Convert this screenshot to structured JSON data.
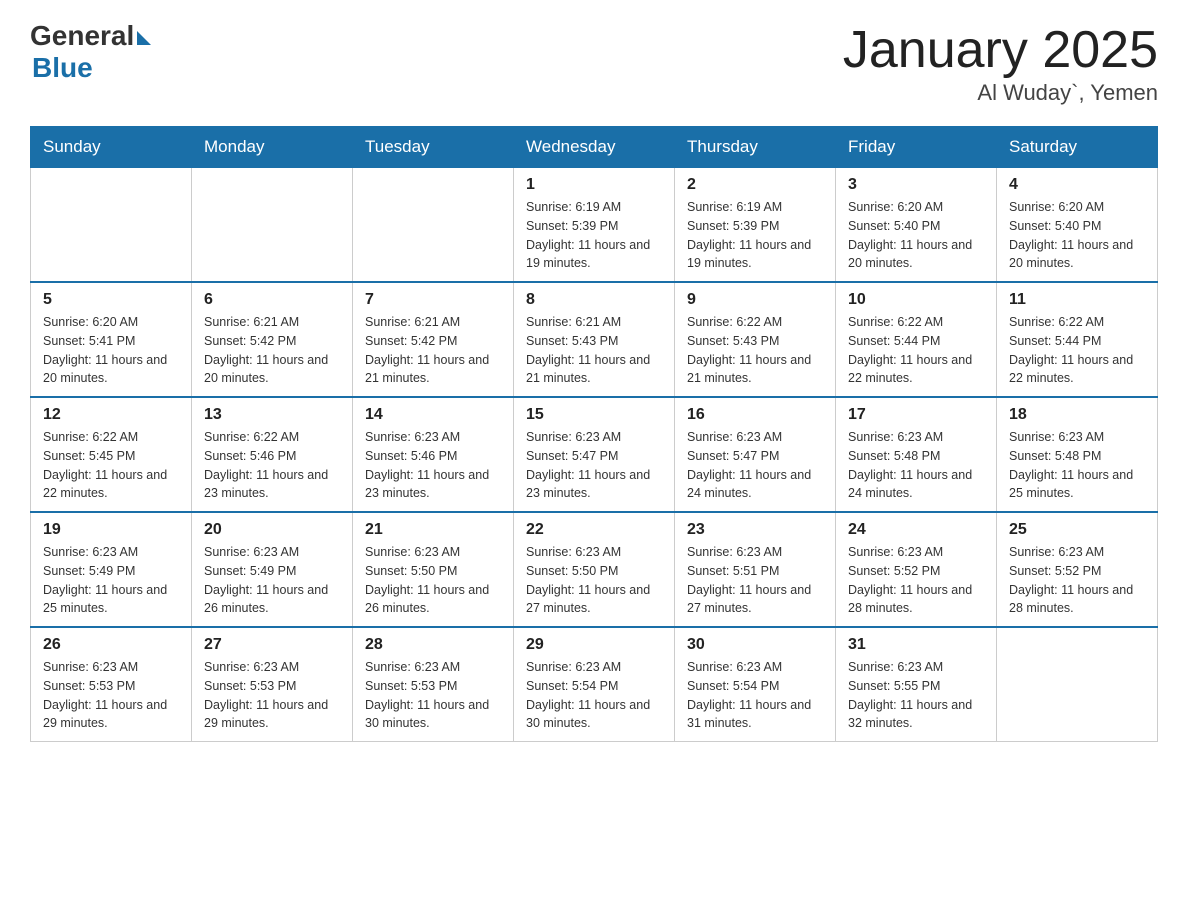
{
  "header": {
    "logo_general": "General",
    "logo_blue": "Blue",
    "month_title": "January 2025",
    "location": "Al Wuday`, Yemen"
  },
  "days_of_week": [
    "Sunday",
    "Monday",
    "Tuesday",
    "Wednesday",
    "Thursday",
    "Friday",
    "Saturday"
  ],
  "weeks": [
    [
      {
        "day": "",
        "info": ""
      },
      {
        "day": "",
        "info": ""
      },
      {
        "day": "",
        "info": ""
      },
      {
        "day": "1",
        "info": "Sunrise: 6:19 AM\nSunset: 5:39 PM\nDaylight: 11 hours and 19 minutes."
      },
      {
        "day": "2",
        "info": "Sunrise: 6:19 AM\nSunset: 5:39 PM\nDaylight: 11 hours and 19 minutes."
      },
      {
        "day": "3",
        "info": "Sunrise: 6:20 AM\nSunset: 5:40 PM\nDaylight: 11 hours and 20 minutes."
      },
      {
        "day": "4",
        "info": "Sunrise: 6:20 AM\nSunset: 5:40 PM\nDaylight: 11 hours and 20 minutes."
      }
    ],
    [
      {
        "day": "5",
        "info": "Sunrise: 6:20 AM\nSunset: 5:41 PM\nDaylight: 11 hours and 20 minutes."
      },
      {
        "day": "6",
        "info": "Sunrise: 6:21 AM\nSunset: 5:42 PM\nDaylight: 11 hours and 20 minutes."
      },
      {
        "day": "7",
        "info": "Sunrise: 6:21 AM\nSunset: 5:42 PM\nDaylight: 11 hours and 21 minutes."
      },
      {
        "day": "8",
        "info": "Sunrise: 6:21 AM\nSunset: 5:43 PM\nDaylight: 11 hours and 21 minutes."
      },
      {
        "day": "9",
        "info": "Sunrise: 6:22 AM\nSunset: 5:43 PM\nDaylight: 11 hours and 21 minutes."
      },
      {
        "day": "10",
        "info": "Sunrise: 6:22 AM\nSunset: 5:44 PM\nDaylight: 11 hours and 22 minutes."
      },
      {
        "day": "11",
        "info": "Sunrise: 6:22 AM\nSunset: 5:44 PM\nDaylight: 11 hours and 22 minutes."
      }
    ],
    [
      {
        "day": "12",
        "info": "Sunrise: 6:22 AM\nSunset: 5:45 PM\nDaylight: 11 hours and 22 minutes."
      },
      {
        "day": "13",
        "info": "Sunrise: 6:22 AM\nSunset: 5:46 PM\nDaylight: 11 hours and 23 minutes."
      },
      {
        "day": "14",
        "info": "Sunrise: 6:23 AM\nSunset: 5:46 PM\nDaylight: 11 hours and 23 minutes."
      },
      {
        "day": "15",
        "info": "Sunrise: 6:23 AM\nSunset: 5:47 PM\nDaylight: 11 hours and 23 minutes."
      },
      {
        "day": "16",
        "info": "Sunrise: 6:23 AM\nSunset: 5:47 PM\nDaylight: 11 hours and 24 minutes."
      },
      {
        "day": "17",
        "info": "Sunrise: 6:23 AM\nSunset: 5:48 PM\nDaylight: 11 hours and 24 minutes."
      },
      {
        "day": "18",
        "info": "Sunrise: 6:23 AM\nSunset: 5:48 PM\nDaylight: 11 hours and 25 minutes."
      }
    ],
    [
      {
        "day": "19",
        "info": "Sunrise: 6:23 AM\nSunset: 5:49 PM\nDaylight: 11 hours and 25 minutes."
      },
      {
        "day": "20",
        "info": "Sunrise: 6:23 AM\nSunset: 5:49 PM\nDaylight: 11 hours and 26 minutes."
      },
      {
        "day": "21",
        "info": "Sunrise: 6:23 AM\nSunset: 5:50 PM\nDaylight: 11 hours and 26 minutes."
      },
      {
        "day": "22",
        "info": "Sunrise: 6:23 AM\nSunset: 5:50 PM\nDaylight: 11 hours and 27 minutes."
      },
      {
        "day": "23",
        "info": "Sunrise: 6:23 AM\nSunset: 5:51 PM\nDaylight: 11 hours and 27 minutes."
      },
      {
        "day": "24",
        "info": "Sunrise: 6:23 AM\nSunset: 5:52 PM\nDaylight: 11 hours and 28 minutes."
      },
      {
        "day": "25",
        "info": "Sunrise: 6:23 AM\nSunset: 5:52 PM\nDaylight: 11 hours and 28 minutes."
      }
    ],
    [
      {
        "day": "26",
        "info": "Sunrise: 6:23 AM\nSunset: 5:53 PM\nDaylight: 11 hours and 29 minutes."
      },
      {
        "day": "27",
        "info": "Sunrise: 6:23 AM\nSunset: 5:53 PM\nDaylight: 11 hours and 29 minutes."
      },
      {
        "day": "28",
        "info": "Sunrise: 6:23 AM\nSunset: 5:53 PM\nDaylight: 11 hours and 30 minutes."
      },
      {
        "day": "29",
        "info": "Sunrise: 6:23 AM\nSunset: 5:54 PM\nDaylight: 11 hours and 30 minutes."
      },
      {
        "day": "30",
        "info": "Sunrise: 6:23 AM\nSunset: 5:54 PM\nDaylight: 11 hours and 31 minutes."
      },
      {
        "day": "31",
        "info": "Sunrise: 6:23 AM\nSunset: 5:55 PM\nDaylight: 11 hours and 32 minutes."
      },
      {
        "day": "",
        "info": ""
      }
    ]
  ]
}
